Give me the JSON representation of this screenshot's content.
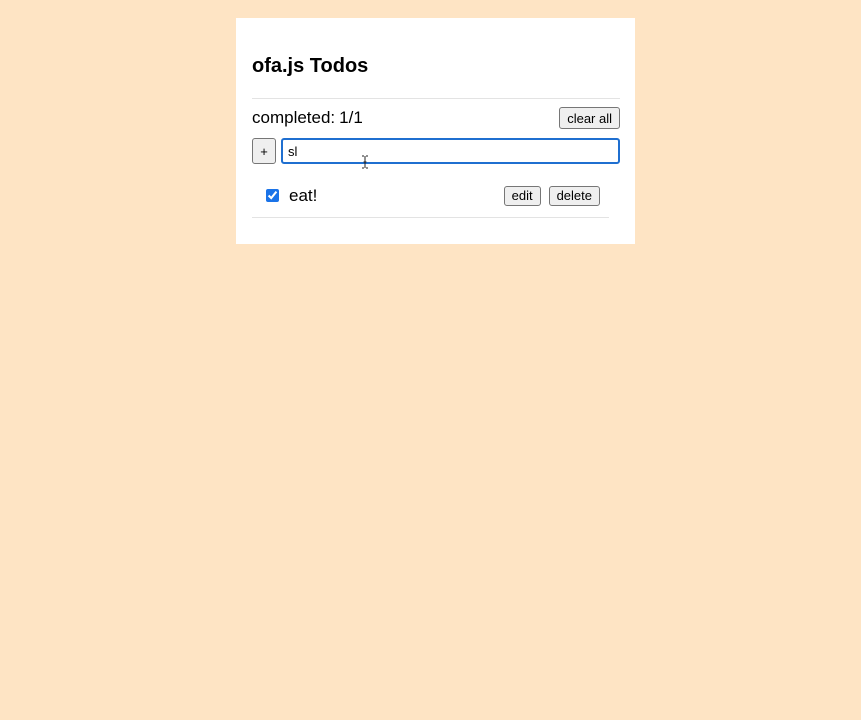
{
  "app": {
    "title": "ofa.js Todos"
  },
  "status": {
    "label": "completed:",
    "count": "1/1",
    "clear_label": "clear all"
  },
  "add": {
    "button_label": "+",
    "input_value": "sl"
  },
  "todos": [
    {
      "label": "eat!",
      "completed": true,
      "edit_label": "edit",
      "delete_label": "delete"
    }
  ],
  "colors": {
    "background": "#fee4c4",
    "card": "#ffffff",
    "focus": "#1f6fd0"
  }
}
